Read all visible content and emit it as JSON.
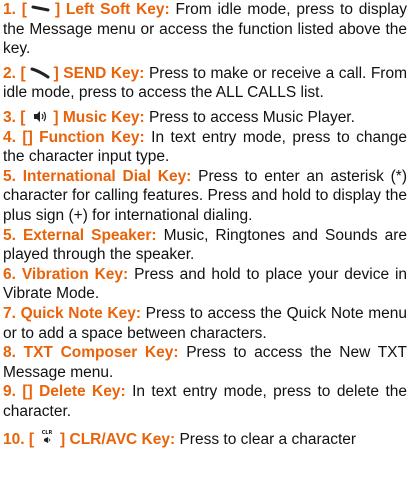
{
  "entries": [
    {
      "num": "1.",
      "open": "[",
      "close": "] Left Soft Key:",
      "icon": "left-soft-key-icon",
      "text": "From idle mode, press to display the Message menu or access the function listed above the key."
    },
    {
      "num": "2.",
      "open": "[",
      "close": "] SEND Key:",
      "icon": "send-key-icon",
      "text": "Press to make or receive a call. From idle mode, press to access the ALL CALLS list."
    },
    {
      "num": "3.",
      "open": "[",
      "close": "] Music Key:",
      "icon": "music-key-icon",
      "text": "Press to access Music Player."
    },
    {
      "num": "4.",
      "label": "[] Function Key:",
      "text": "In text entry mode, press to change the character input type."
    },
    {
      "num": "5.",
      "label": "International Dial Key:",
      "text": "Press to enter an asterisk (*) character for calling features. Press and hold to display the plus sign (+) for international dialing."
    },
    {
      "num": "5.",
      "label": "External Speaker:",
      "text": "Music, Ringtones and Sounds are played through the speaker."
    },
    {
      "num": "6.",
      "label": "Vibration Key:",
      "text": "Press and hold to place your device in Vibrate Mode."
    },
    {
      "num": "7.",
      "label": "Quick Note Key:",
      "text": "Press to access the Quick Note menu or to add a space between characters."
    },
    {
      "num": "8.",
      "label": "TXT Composer Key:",
      "text": "Press to access the New TXT Message menu."
    },
    {
      "num": "9.",
      "label": "[] Delete Key:",
      "text": "In text entry mode, press to delete the character."
    },
    {
      "num": "10.",
      "open": "[",
      "close": "] CLR/AVC Key:",
      "icon": "clr-key-icon",
      "icon_text": "CLR",
      "text": "Press to clear a character"
    }
  ],
  "colors": {
    "accent": "#e8630a",
    "body_text": "#111111"
  }
}
